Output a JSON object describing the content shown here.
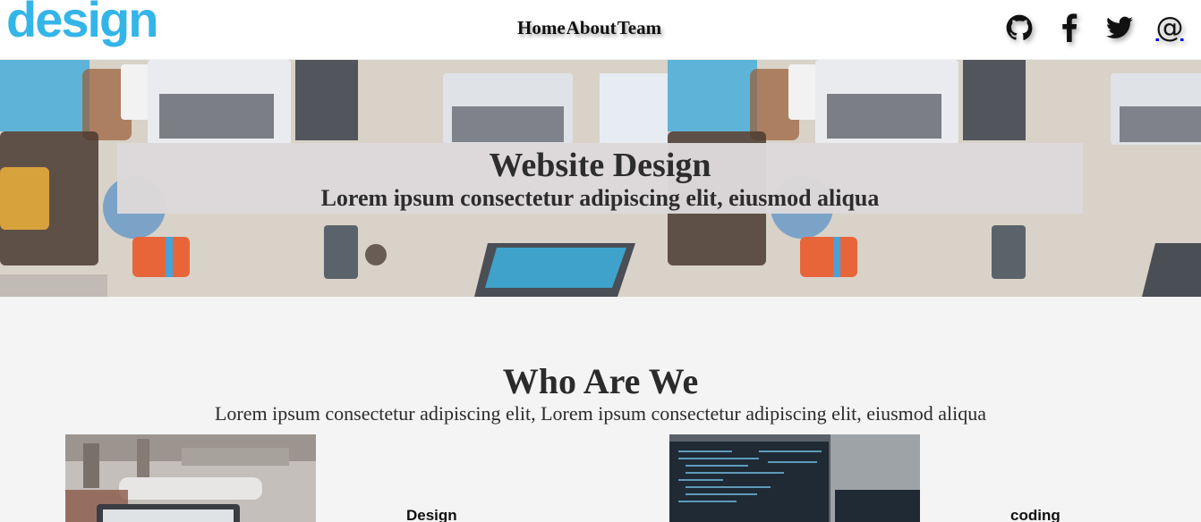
{
  "header": {
    "logo": "design",
    "nav": [
      {
        "label": "Home"
      },
      {
        "label": "About"
      },
      {
        "label": "Team"
      }
    ],
    "socials": [
      {
        "icon": "github-icon"
      },
      {
        "icon": "facebook-icon"
      },
      {
        "icon": "twitter-icon"
      },
      {
        "icon": "email-at-icon",
        "glyph": "@"
      }
    ]
  },
  "hero": {
    "title": "Website Design",
    "subtitle": "Lorem ipsum consectetur adipiscing elit, eiusmod aliqua"
  },
  "who": {
    "title": "Who Are We",
    "text": "Lorem ipsum consectetur adipiscing elit, Lorem ipsum consectetur adipiscing elit, eiusmod aliqua",
    "cards": [
      {
        "label": "Design"
      },
      {
        "label": "coding"
      }
    ]
  },
  "colors": {
    "logo": "#34b5e8",
    "background": "#f4f4f4",
    "overlay": "#ddd9da"
  }
}
